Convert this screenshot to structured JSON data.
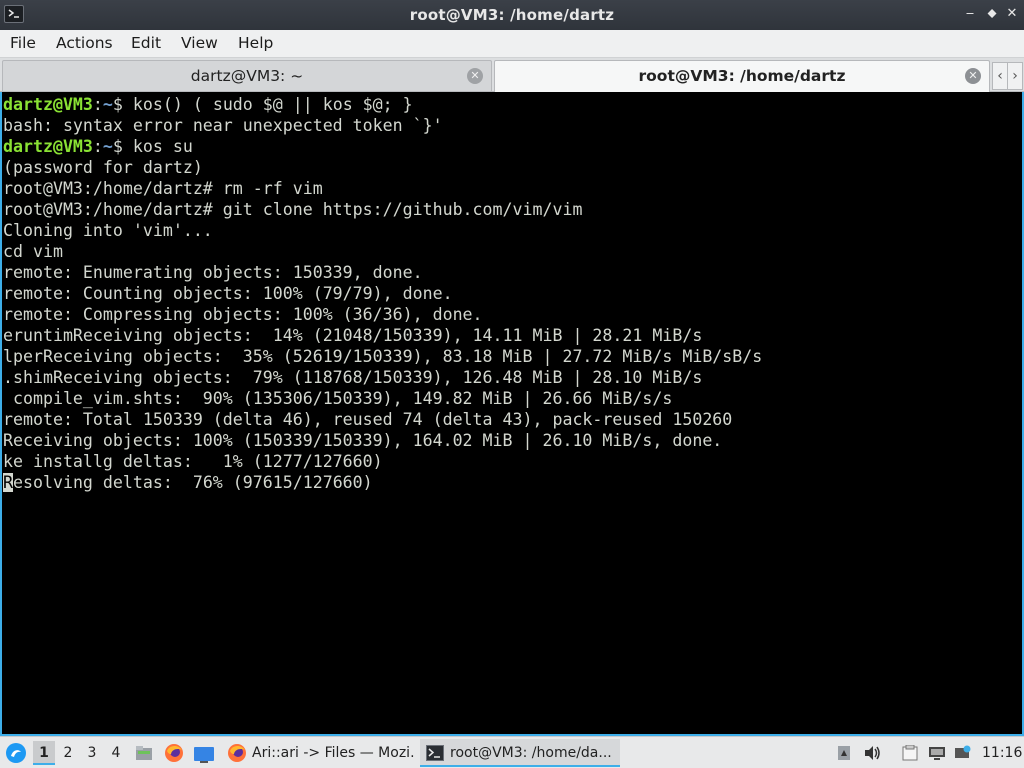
{
  "window": {
    "title": "root@VM3: /home/dartz",
    "controls": {
      "minimize": "‒",
      "maximize": "⬥",
      "close": "✕"
    }
  },
  "menubar": {
    "items": [
      "File",
      "Actions",
      "Edit",
      "View",
      "Help"
    ]
  },
  "tabs": [
    {
      "label": "dartz@VM3: ~",
      "active": false
    },
    {
      "label": "root@VM3: /home/dartz",
      "active": true
    }
  ],
  "tabnav": {
    "prev": "‹",
    "next": "›"
  },
  "terminal": {
    "lines": [
      {
        "user": "dartz@VM3",
        "path": "~",
        "cmd": "$ kos() ( sudo $@ || kos $@; }"
      },
      {
        "text": "bash: syntax error near unexpected token `}'"
      },
      {
        "user": "dartz@VM3",
        "path": "~",
        "cmd": "$ kos su"
      },
      {
        "text": "(password for dartz)"
      },
      {
        "text": "root@VM3:/home/dartz# rm -rf vim"
      },
      {
        "text": "root@VM3:/home/dartz# git clone https://github.com/vim/vim"
      },
      {
        "text": "Cloning into 'vim'..."
      },
      {
        "text": "cd vim"
      },
      {
        "text": "remote: Enumerating objects: 150339, done."
      },
      {
        "text": "remote: Counting objects: 100% (79/79), done."
      },
      {
        "text": "remote: Compressing objects: 100% (36/36), done."
      },
      {
        "text": "eruntimReceiving objects:  14% (21048/150339), 14.11 MiB | 28.21 MiB/s"
      },
      {
        "text": "lperReceiving objects:  35% (52619/150339), 83.18 MiB | 27.72 MiB/s MiB/sB/s"
      },
      {
        "text": ".shimReceiving objects:  79% (118768/150339), 126.48 MiB | 28.10 MiB/s"
      },
      {
        "text": " compile_vim.shts:  90% (135306/150339), 149.82 MiB | 26.66 MiB/s/s"
      },
      {
        "text": "remote: Total 150339 (delta 46), reused 74 (delta 43), pack-reused 150260"
      },
      {
        "text": "Receiving objects: 100% (150339/150339), 164.02 MiB | 26.10 MiB/s, done."
      },
      {
        "text": "ke installg deltas:   1% (1277/127660)"
      },
      {
        "cursor": "R",
        "text": "esolving deltas:  76% (97615/127660)"
      }
    ]
  },
  "taskbar": {
    "workspaces": [
      "1",
      "2",
      "3",
      "4"
    ],
    "active_workspace": "1",
    "tasks": [
      {
        "label": "Ari::ari -> Files — Mozi...",
        "icon": "firefox-icon",
        "active": false
      },
      {
        "label": "root@VM3: /home/da...",
        "icon": "terminal-icon",
        "active": true
      }
    ],
    "clock": "11:16"
  },
  "colors": {
    "accent": "#3daee9",
    "prompt_user": "#8ae234",
    "prompt_path": "#729fcf",
    "terminal_fg": "#d3d7cf"
  }
}
